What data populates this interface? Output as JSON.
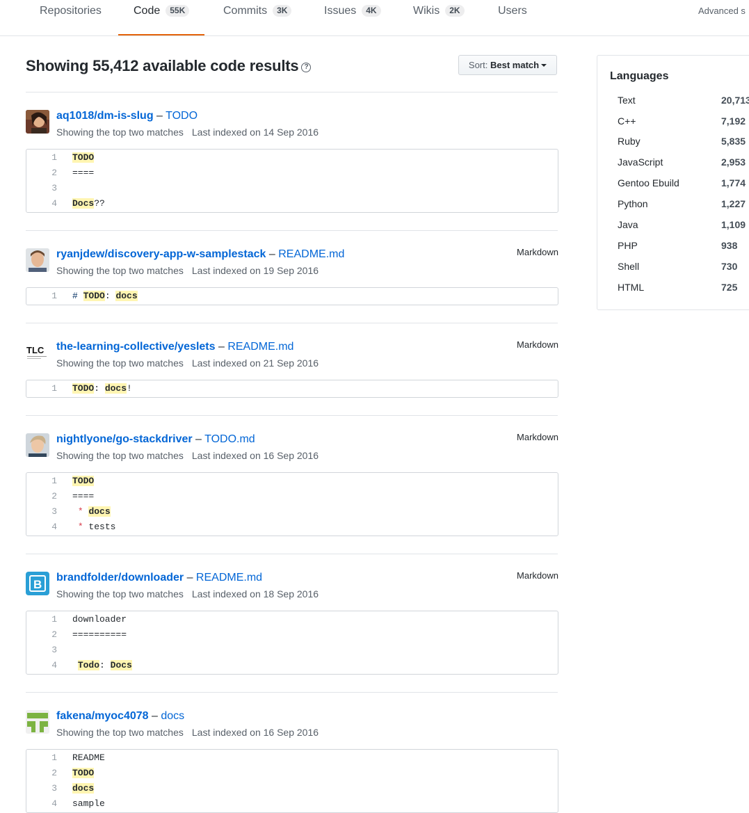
{
  "tabs": [
    {
      "label": "Repositories",
      "count": ""
    },
    {
      "label": "Code",
      "count": "55K"
    },
    {
      "label": "Commits",
      "count": "3K"
    },
    {
      "label": "Issues",
      "count": "4K"
    },
    {
      "label": "Wikis",
      "count": "2K"
    },
    {
      "label": "Users",
      "count": ""
    }
  ],
  "advanced_search": "Advanced s",
  "heading": "Showing 55,412 available code results",
  "sort": {
    "label": "Sort:",
    "value": "Best match"
  },
  "results": [
    {
      "repo": "aq1018/dm-is-slug",
      "file": "TODO",
      "language": "",
      "matches": "Showing the top two matches",
      "indexed": "Last indexed on 14 Sep 2016",
      "lines": [
        {
          "n": "1",
          "parts": [
            {
              "t": "TODO",
              "h": true
            }
          ]
        },
        {
          "n": "2",
          "parts": [
            {
              "t": "===="
            }
          ]
        },
        {
          "n": "3",
          "parts": [
            {
              "t": ""
            }
          ]
        },
        {
          "n": "4",
          "parts": [
            {
              "t": "Docs",
              "h": true
            },
            {
              "t": "??"
            }
          ]
        }
      ]
    },
    {
      "repo": "ryanjdew/discovery-app-w-samplestack",
      "file": "README.md",
      "language": "Markdown",
      "matches": "Showing the top two matches",
      "indexed": "Last indexed on 19 Sep 2016",
      "lines": [
        {
          "n": "1",
          "parts": [
            {
              "t": "# ",
              "c": "#032f62"
            },
            {
              "t": "TODO",
              "h": true
            },
            {
              "t": ": "
            },
            {
              "t": "docs",
              "h": true
            }
          ]
        }
      ]
    },
    {
      "repo": "the-learning-collective/yeslets",
      "file": "README.md",
      "language": "Markdown",
      "matches": "Showing the top two matches",
      "indexed": "Last indexed on 21 Sep 2016",
      "lines": [
        {
          "n": "1",
          "parts": [
            {
              "t": "TODO",
              "h": true
            },
            {
              "t": ": "
            },
            {
              "t": "docs",
              "h": true
            },
            {
              "t": "!"
            }
          ]
        }
      ]
    },
    {
      "repo": "nightlyone/go-stackdriver",
      "file": "TODO.md",
      "language": "Markdown",
      "matches": "Showing the top two matches",
      "indexed": "Last indexed on 16 Sep 2016",
      "lines": [
        {
          "n": "1",
          "parts": [
            {
              "t": "TODO",
              "h": true
            }
          ]
        },
        {
          "n": "2",
          "parts": [
            {
              "t": "===="
            }
          ]
        },
        {
          "n": "3",
          "parts": [
            {
              "t": " "
            },
            {
              "t": "*",
              "s": true
            },
            {
              "t": " "
            },
            {
              "t": "docs",
              "h": true
            }
          ]
        },
        {
          "n": "4",
          "parts": [
            {
              "t": " "
            },
            {
              "t": "*",
              "s": true
            },
            {
              "t": " tests"
            }
          ]
        }
      ]
    },
    {
      "repo": "brandfolder/downloader",
      "file": "README.md",
      "language": "Markdown",
      "matches": "Showing the top two matches",
      "indexed": "Last indexed on 18 Sep 2016",
      "lines": [
        {
          "n": "1",
          "parts": [
            {
              "t": "downloader"
            }
          ]
        },
        {
          "n": "2",
          "parts": [
            {
              "t": "=========="
            }
          ]
        },
        {
          "n": "3",
          "parts": [
            {
              "t": ""
            }
          ]
        },
        {
          "n": "4",
          "parts": [
            {
              "t": " "
            },
            {
              "t": "Todo",
              "h": true
            },
            {
              "t": ": "
            },
            {
              "t": "Docs",
              "h": true
            }
          ]
        }
      ]
    },
    {
      "repo": "fakena/myoc4078",
      "file": "docs",
      "language": "",
      "matches": "Showing the top two matches",
      "indexed": "Last indexed on 16 Sep 2016",
      "lines": [
        {
          "n": "1",
          "parts": [
            {
              "t": "README"
            }
          ]
        },
        {
          "n": "2",
          "parts": [
            {
              "t": "TODO",
              "h": true
            }
          ]
        },
        {
          "n": "3",
          "parts": [
            {
              "t": "docs",
              "h": true
            }
          ]
        },
        {
          "n": "4",
          "parts": [
            {
              "t": "sample"
            }
          ]
        }
      ]
    }
  ],
  "languages": {
    "title": "Languages",
    "items": [
      {
        "name": "Text",
        "count": "20,713"
      },
      {
        "name": "C++",
        "count": "7,192"
      },
      {
        "name": "Ruby",
        "count": "5,835"
      },
      {
        "name": "JavaScript",
        "count": "2,953"
      },
      {
        "name": "Gentoo Ebuild",
        "count": "1,774"
      },
      {
        "name": "Python",
        "count": "1,227"
      },
      {
        "name": "Java",
        "count": "1,109"
      },
      {
        "name": "PHP",
        "count": "938"
      },
      {
        "name": "Shell",
        "count": "730"
      },
      {
        "name": "HTML",
        "count": "725"
      }
    ]
  },
  "colors": {
    "link": "#0366d6",
    "highlight": "#fff5b1",
    "tab_underline": "#e36209"
  }
}
